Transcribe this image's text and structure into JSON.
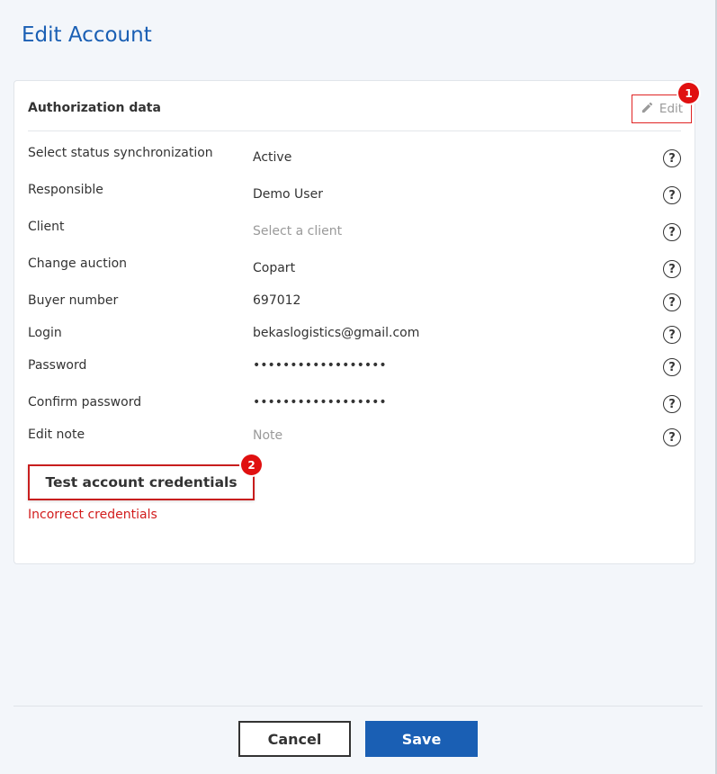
{
  "page": {
    "title": "Edit Account"
  },
  "card": {
    "section_title": "Authorization data",
    "edit_label": "Edit",
    "badge_1": "1",
    "badge_2": "2"
  },
  "fields": [
    {
      "label": "Select status synchronization",
      "value": "Active",
      "placeholder": false
    },
    {
      "label": "Responsible",
      "value": "Demo User",
      "placeholder": false
    },
    {
      "label": "Client",
      "value": "Select a client",
      "placeholder": true
    },
    {
      "label": "Change auction",
      "value": "Copart",
      "placeholder": false
    },
    {
      "label": "Buyer number",
      "value": "697012",
      "placeholder": false
    },
    {
      "label": "Login",
      "value": "bekaslogistics@gmail.com",
      "placeholder": false
    },
    {
      "label": "Password",
      "value": "••••••••••••••••••",
      "placeholder": false
    },
    {
      "label": "Confirm password",
      "value": "••••••••••••••••••",
      "placeholder": false
    },
    {
      "label": "Edit note",
      "value": "Note",
      "placeholder": true
    }
  ],
  "help_glyph": "?",
  "test_button": {
    "label": "Test account credentials"
  },
  "error": {
    "text": "Incorrect credentials"
  },
  "footer": {
    "cancel_label": "Cancel",
    "save_label": "Save"
  },
  "colors": {
    "accent": "#1a5fb4",
    "error": "#d21c1c",
    "highlight_border": "#e02424"
  },
  "icons": {
    "edit": "pencil-icon",
    "help": "question-circle-icon"
  }
}
